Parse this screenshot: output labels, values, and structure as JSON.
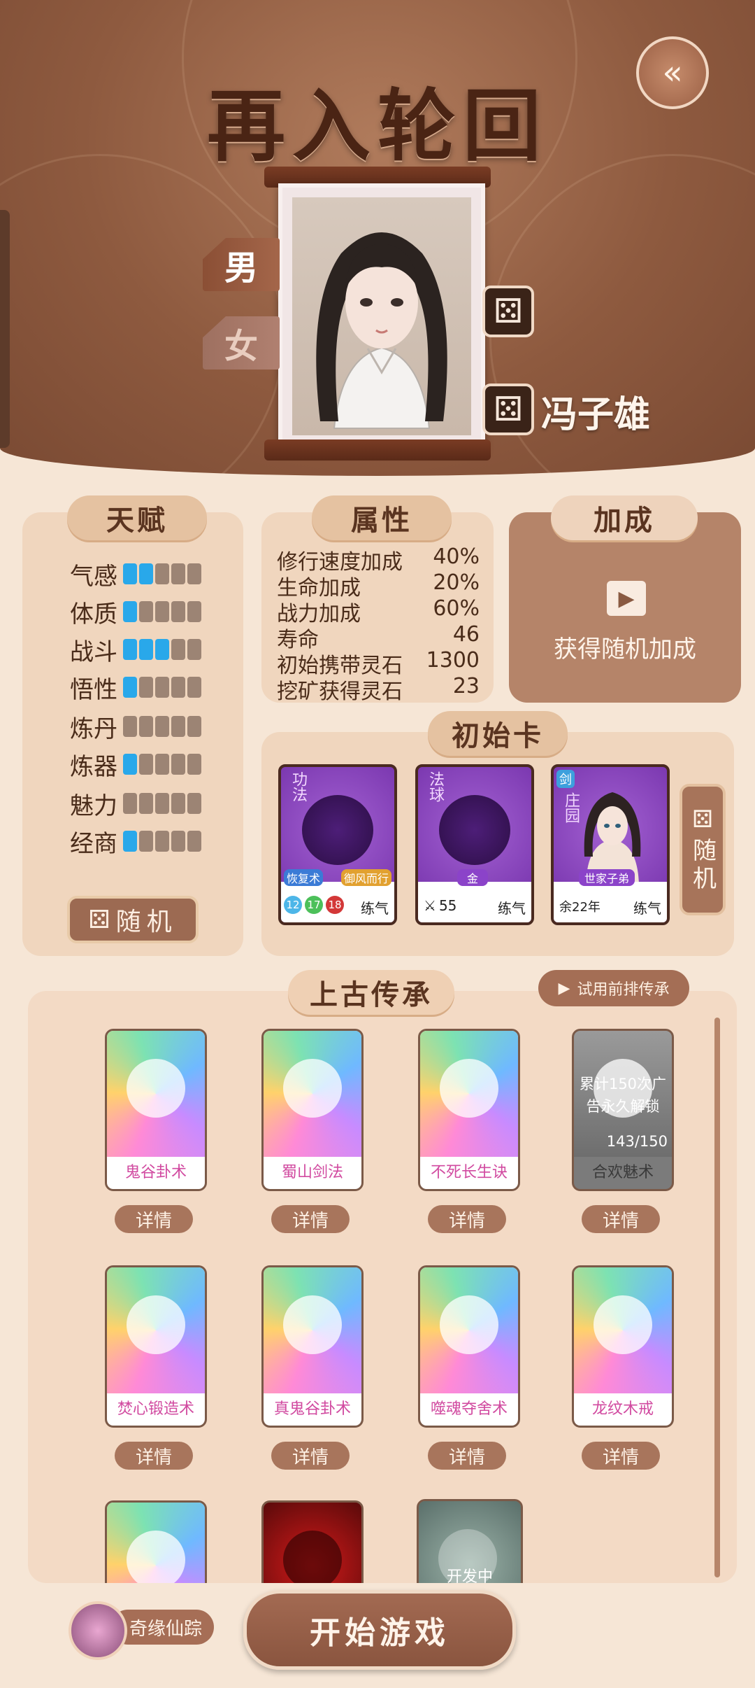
{
  "header": {
    "title": "再入轮回",
    "back_icon": "back-arrow-icon",
    "gender_male": "男",
    "gender_female": "女",
    "character_name": "冯子雄"
  },
  "talent": {
    "title": "天赋",
    "random_label": "随机",
    "items": [
      {
        "name": "气感",
        "level": 2
      },
      {
        "name": "体质",
        "level": 1
      },
      {
        "name": "战斗",
        "level": 3
      },
      {
        "name": "悟性",
        "level": 1
      },
      {
        "name": "炼丹",
        "level": 0
      },
      {
        "name": "炼器",
        "level": 1
      },
      {
        "name": "魅力",
        "level": 0
      },
      {
        "name": "经商",
        "level": 1
      }
    ],
    "max_level": 5,
    "active_color": "#29a8ea"
  },
  "attributes": {
    "title": "属性",
    "items": [
      {
        "label": "修行速度加成",
        "value": "40%"
      },
      {
        "label": "生命加成",
        "value": "20%"
      },
      {
        "label": "战力加成",
        "value": "60%"
      },
      {
        "label": "寿命",
        "value": "46"
      },
      {
        "label": "初始携带灵石",
        "value": "1300"
      },
      {
        "label": "挖矿获得灵石",
        "value": "23"
      }
    ]
  },
  "bonus": {
    "title": "加成",
    "action_label": "获得随机加成"
  },
  "initial_cards": {
    "title": "初始卡",
    "random_label": "随机",
    "cards": [
      {
        "tag": "功法",
        "chip1": "恢复术",
        "chip2": "御风而行",
        "stats": [
          "12",
          "17",
          "18"
        ],
        "realm": "练气"
      },
      {
        "tag": "法球",
        "element": "金",
        "power": "55",
        "realm": "练气"
      },
      {
        "tag": "庄园",
        "badge": "剑",
        "identity": "世家子弟",
        "years": "余22年",
        "realm": "练气"
      }
    ]
  },
  "legacy": {
    "title": "上古传承",
    "trial_label": "试用前排传承",
    "detail_label": "详情",
    "locked_text": "累计150次广告永久解锁",
    "locked_progress": "143/150",
    "dev_label": "开发中",
    "items": [
      {
        "name": "鬼谷卦术"
      },
      {
        "name": "蜀山剑法"
      },
      {
        "name": "不死长生诀"
      },
      {
        "name": "合欢魅术"
      },
      {
        "name": "焚心锻造术"
      },
      {
        "name": "真鬼谷卦术"
      },
      {
        "name": "噬魂夺舍术"
      },
      {
        "name": "龙纹木戒"
      }
    ]
  },
  "footer": {
    "fate_label": "奇缘仙踪",
    "start_label": "开始游戏"
  }
}
